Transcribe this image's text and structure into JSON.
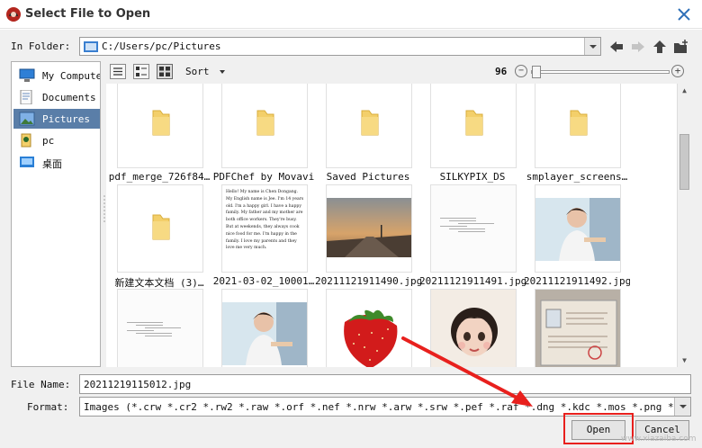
{
  "window": {
    "title": "Select File to Open"
  },
  "folder": {
    "label": "In Folder:",
    "path": "C:/Users/pc/Pictures"
  },
  "places": [
    {
      "label": "My Computer",
      "icon": "computer-icon",
      "selected": false
    },
    {
      "label": "Documents",
      "icon": "documents-icon",
      "selected": false
    },
    {
      "label": "Pictures",
      "icon": "pictures-icon",
      "selected": true
    },
    {
      "label": "pc",
      "icon": "user-icon",
      "selected": false
    },
    {
      "label": "桌面",
      "icon": "desktop-icon",
      "selected": false
    }
  ],
  "toolbar": {
    "sort_label": "Sort",
    "zoom_value": "96",
    "zoom_minus": "−",
    "zoom_plus": "+"
  },
  "files": [
    {
      "name": "pdf_merge_726f84…",
      "kind": "folder"
    },
    {
      "name": "PDFChef by Movavi",
      "kind": "folder"
    },
    {
      "name": "Saved Pictures",
      "kind": "folder"
    },
    {
      "name": "SILKYPIX_DS",
      "kind": "folder"
    },
    {
      "name": "smplayer_screens…",
      "kind": "folder"
    },
    {
      "name": "新建文本文档 (3)…",
      "kind": "folder"
    },
    {
      "name": "2021-03-02_10001…",
      "kind": "text-doc"
    },
    {
      "name": "20211121911490.jpg",
      "kind": "road-photo"
    },
    {
      "name": "20211121911491.jpg",
      "kind": "doc-scan"
    },
    {
      "name": "20211121911492.jpg",
      "kind": "boy-photo"
    },
    {
      "name": "",
      "kind": "doc-scan"
    },
    {
      "name": "",
      "kind": "boy-photo"
    },
    {
      "name": "",
      "kind": "strawberry"
    },
    {
      "name": "",
      "kind": "girl-drawing"
    },
    {
      "name": "",
      "kind": "certificate"
    }
  ],
  "doc_preview_text": "Hello! My name is Chen Dongang. My English name is Jee. I'm 14 years old. I'm a happy girl. I have a happy family. My father and my mother are both office workers. They're busy. But at weekends, they always cook nice food for me. I'm happy in the family. I love my parents and they love me very much.",
  "filename": {
    "label": "File Name:",
    "value": "20211219115012.jpg"
  },
  "format": {
    "label": "Format:",
    "value": "Images (*.crw *.cr2 *.rw2 *.raw *.orf *.nef *.nrw *.arw *.srw *.pef *.raf *.dng *.kdc *.mos *.png *.bmp *.jp"
  },
  "buttons": {
    "open": "Open",
    "cancel": "Cancel"
  },
  "colors": {
    "selection": "#5a7ea8",
    "folder": "#f3cf6a",
    "highlight": "#e8201d"
  },
  "watermark": "www.xiazaiba.com"
}
